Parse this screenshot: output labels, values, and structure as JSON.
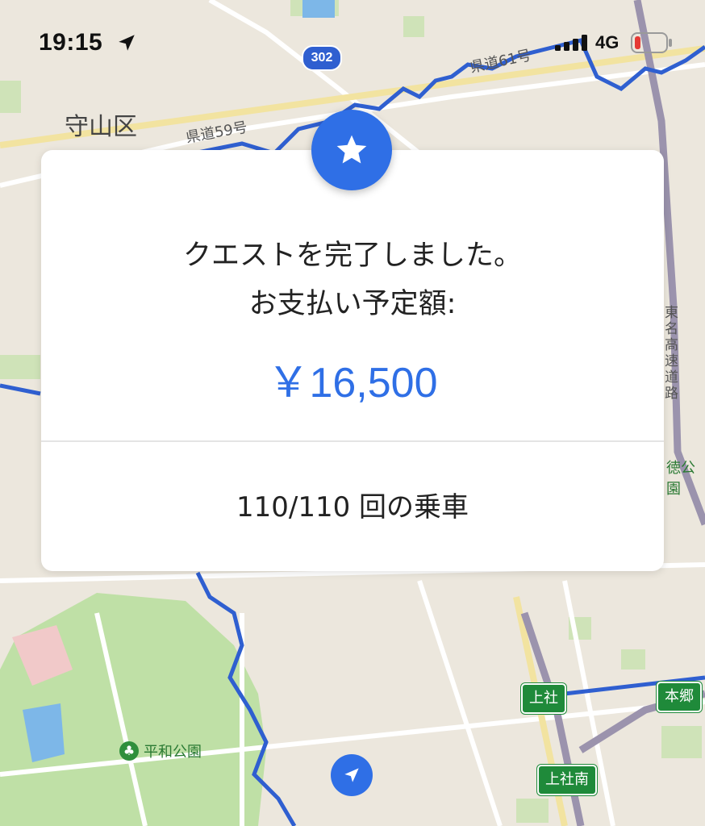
{
  "status_bar": {
    "time": "19:15",
    "network": "4G"
  },
  "map": {
    "labels": {
      "district": "守山区",
      "road_59": "県道59号",
      "road_61": "県道61号",
      "route_302": "302",
      "expressway": "東名高速道路",
      "park_edge": "徳公園",
      "park": "平和公園"
    },
    "stations": {
      "kamiyashiro": "上社",
      "hongo": "本郷",
      "kamiyashiro_minami": "上社南"
    }
  },
  "card": {
    "message_line1": "クエストを完了しました。",
    "message_line2": "お支払い予定額:",
    "amount": "￥16,500",
    "rides": "110/110 回の乗車"
  },
  "colors": {
    "accent": "#2f6fe6",
    "station_green": "#1f8a3a"
  }
}
